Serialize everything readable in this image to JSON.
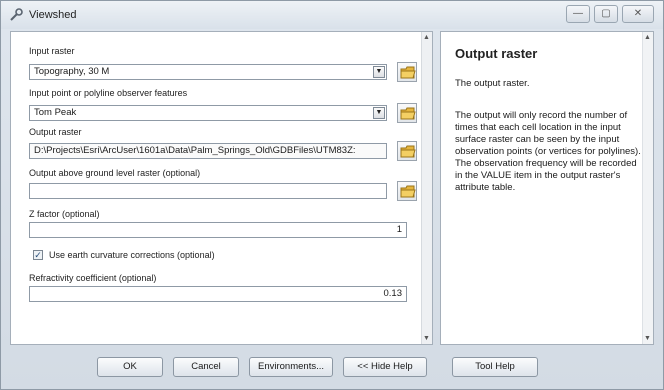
{
  "window": {
    "title": "Viewshed",
    "controls": {
      "minimize": "—",
      "maximize": "▢",
      "close": "✕"
    },
    "accent_bar_color": "#2e8b2e"
  },
  "form": {
    "input_raster": {
      "label": "Input raster",
      "value": "Topography, 30 M"
    },
    "observer_features": {
      "label": "Input point or polyline observer features",
      "value": "Tom Peak"
    },
    "output_raster": {
      "label": "Output raster",
      "value": "D:\\Projects\\Esri\\ArcUser\\1601a\\Data\\Palm_Springs_Old\\GDBFiles\\UTM83Z:"
    },
    "above_ground": {
      "label": "Output above ground level raster (optional)",
      "value": ""
    },
    "z_factor": {
      "label": "Z factor (optional)",
      "value": "1"
    },
    "earth_curvature": {
      "label": "Use earth curvature corrections (optional)",
      "checked": true,
      "mark": "✓"
    },
    "refractivity": {
      "label": "Refractivity coefficient (optional)",
      "value": "0.13"
    }
  },
  "help": {
    "title": "Output raster",
    "p1": "The output raster.",
    "p2": "The output will only record the number of times that each cell location in the input surface raster can be seen by the input observation points (or vertices for polylines). The observation frequency will be recorded in the VALUE item in the output raster's attribute table."
  },
  "buttons": {
    "ok": "OK",
    "cancel": "Cancel",
    "environments": "Environments...",
    "hide_help": "<< Hide Help",
    "tool_help": "Tool Help"
  },
  "icons": {
    "title": "wrench-tool-icon",
    "folder": "open-folder-icon",
    "dropdown": "dropdown-arrow-icon"
  }
}
